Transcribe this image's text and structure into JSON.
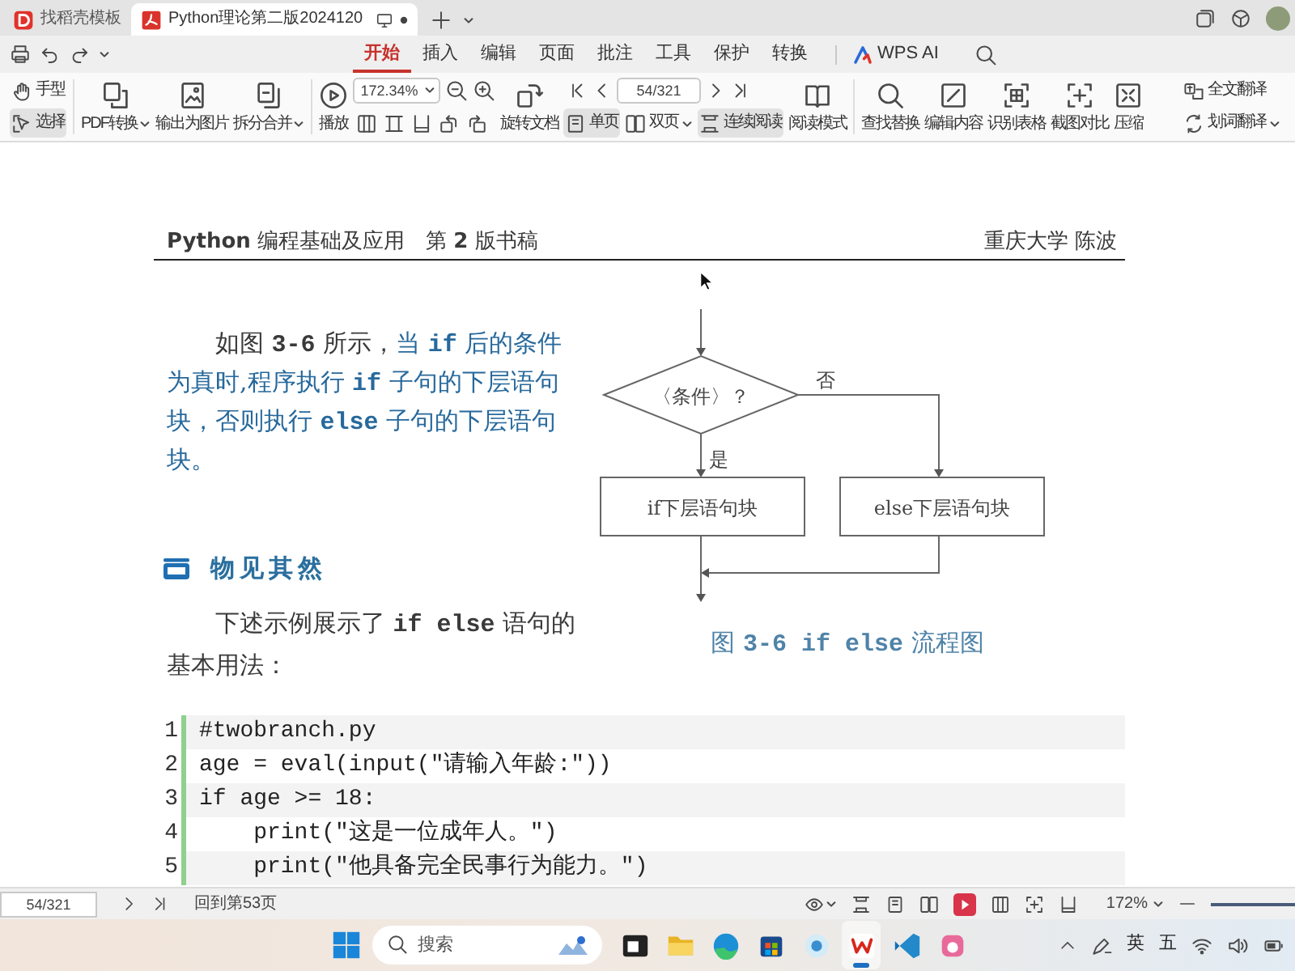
{
  "tabs": [
    {
      "label": "找稻壳模板",
      "selected": false
    },
    {
      "label": "Python理论第二版2024120",
      "selected": true
    }
  ],
  "ribbon_tabs": [
    {
      "label": "开始",
      "selected": true
    },
    {
      "label": "插入",
      "selected": false
    },
    {
      "label": "编辑",
      "selected": false
    },
    {
      "label": "页面",
      "selected": false
    },
    {
      "label": "批注",
      "selected": false
    },
    {
      "label": "工具",
      "selected": false
    },
    {
      "label": "保护",
      "selected": false
    },
    {
      "label": "转换",
      "selected": false
    }
  ],
  "ai_button": "WPS AI",
  "toolbar": {
    "pointer_tools": [
      {
        "label": "手型",
        "selected": false
      },
      {
        "label": "选择",
        "selected": true
      }
    ],
    "convert_buttons": [
      {
        "label": "PDF转换",
        "dropdown": true
      },
      {
        "label": "输出为图片",
        "dropdown": false
      },
      {
        "label": "拆分合并",
        "dropdown": true
      }
    ],
    "play_button": "播放",
    "zoom_value": "172.34%",
    "rotate_button": "旋转文档",
    "page_value": "54/321",
    "view_modes": [
      {
        "label": "单页",
        "selected": true,
        "dropdown": false
      },
      {
        "label": "双页",
        "selected": false,
        "dropdown": true
      },
      {
        "label": "连续阅读",
        "selected": true,
        "dropdown": false
      }
    ],
    "reading_mode_button": "阅读模式",
    "tool_buttons": [
      "查找替换",
      "编辑内容",
      "识别表格",
      "截图对比",
      "压缩"
    ],
    "translate_buttons": [
      {
        "label": "全文翻译",
        "dropdown": false
      },
      {
        "label": "划词翻译",
        "dropdown": true
      }
    ]
  },
  "document": {
    "header_left": "**Python** 编程基础及应用　第 **2** 版书稿",
    "header_right": "重庆大学 陈波",
    "intro": {
      "lead": "如图 **3-6** 所示，",
      "highlight": "当 **if** 后的条件为真时,程序执行 **if** 子句的下层语句块，否则执行 **else** 子句的下层语句块。"
    },
    "section_title": "物见其然",
    "example_intro": "下述示例展示了 **if else** 语句的基本用法：",
    "flowchart": {
      "condition": "〈条件〉？",
      "no_label": "否",
      "yes_label": "是",
      "if_block": "if下层语句块",
      "else_block": "else下层语句块"
    },
    "figure_caption": "图 **3-6 if else** 流程图",
    "code_lines": [
      {
        "number": "1",
        "code": "#twobranch.py"
      },
      {
        "number": "2",
        "code": "age = eval(input(\"请输入年龄:\"))"
      },
      {
        "number": "3",
        "code": "if age >= 18:"
      },
      {
        "number": "4",
        "code": "    print(\"这是一位成年人。\")"
      },
      {
        "number": "5",
        "code": "    print(\"他具备完全民事行为能力。\")"
      }
    ]
  },
  "status_bar": {
    "page_value": "54/321",
    "back_link": "回到第53页",
    "zoom": "172%"
  },
  "taskbar": {
    "search_placeholder": "搜索",
    "apps": [
      {
        "active": false
      },
      {
        "active": false
      },
      {
        "active": false
      },
      {
        "active": false
      },
      {
        "active": false
      },
      {
        "active": true
      },
      {
        "active": false
      },
      {
        "active": false
      }
    ],
    "input_indicators": [
      "英",
      "五"
    ]
  }
}
